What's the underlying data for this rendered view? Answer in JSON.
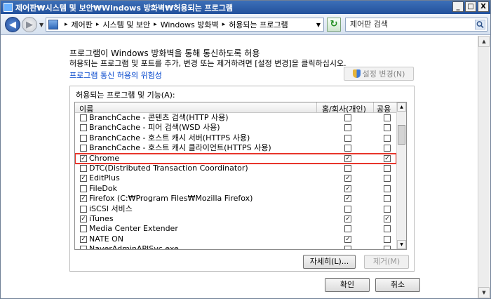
{
  "window": {
    "title": "제어판₩시스템 및 보안₩Windows 방화벽₩허용되는 프로그램",
    "controls": [
      "_",
      "□",
      "X"
    ]
  },
  "address": {
    "back_glyph": "◀",
    "forward_glyph": "▶",
    "crumbs": [
      "제어판",
      "시스템 및 보안",
      "Windows 방화벽",
      "허용되는 프로그램"
    ],
    "search_placeholder": "제어판 검색"
  },
  "page": {
    "heading": "프로그램이 Windows 방화벽을 통해 통신하도록 허용",
    "subtext": "허용되는 프로그램 및 포트를 추가, 변경 또는 제거하려면 [설정 변경]을 클릭하십시오.",
    "risk_link": "프로그램 통신 허용의 위험성",
    "change_settings": "설정 변경(N)"
  },
  "list": {
    "group_label": "허용되는 프로그램 및 기능(A):",
    "col_name": "이름",
    "col_home": "홈/회사(개인)",
    "col_public": "공용",
    "rows": [
      {
        "name": "BranchCache - 콘텐츠 검색(HTTP 사용)",
        "enabled": false,
        "home": false,
        "public": false
      },
      {
        "name": "BranchCache - 피어 검색(WSD 사용)",
        "enabled": false,
        "home": false,
        "public": false
      },
      {
        "name": "BranchCache - 호스트 캐시 서버(HTTPS 사용)",
        "enabled": false,
        "home": false,
        "public": false
      },
      {
        "name": "BranchCache - 호스트 캐시 클라이언트(HTTPS 사용)",
        "enabled": false,
        "home": false,
        "public": false
      },
      {
        "name": "Chrome",
        "enabled": true,
        "home": true,
        "public": true,
        "highlight": true
      },
      {
        "name": "DTC(Distributed Transaction Coordinator)",
        "enabled": false,
        "home": false,
        "public": false
      },
      {
        "name": "EditPlus",
        "enabled": true,
        "home": true,
        "public": false
      },
      {
        "name": "FileDok",
        "enabled": false,
        "home": true,
        "public": false
      },
      {
        "name": "Firefox (C:₩Program Files₩Mozilla Firefox)",
        "enabled": true,
        "home": true,
        "public": false
      },
      {
        "name": "iSCSI 서비스",
        "enabled": false,
        "home": false,
        "public": false
      },
      {
        "name": "iTunes",
        "enabled": true,
        "home": true,
        "public": true
      },
      {
        "name": "Media Center Extender",
        "enabled": false,
        "home": false,
        "public": false
      },
      {
        "name": "NATE ON",
        "enabled": true,
        "home": true,
        "public": false
      },
      {
        "name": "NaverAdminAPISvc.exe",
        "enabled": false,
        "home": false,
        "public": false
      }
    ]
  },
  "buttons": {
    "details": "자세히(L)...",
    "remove": "제거(M)",
    "ok": "확인",
    "cancel": "취소"
  }
}
